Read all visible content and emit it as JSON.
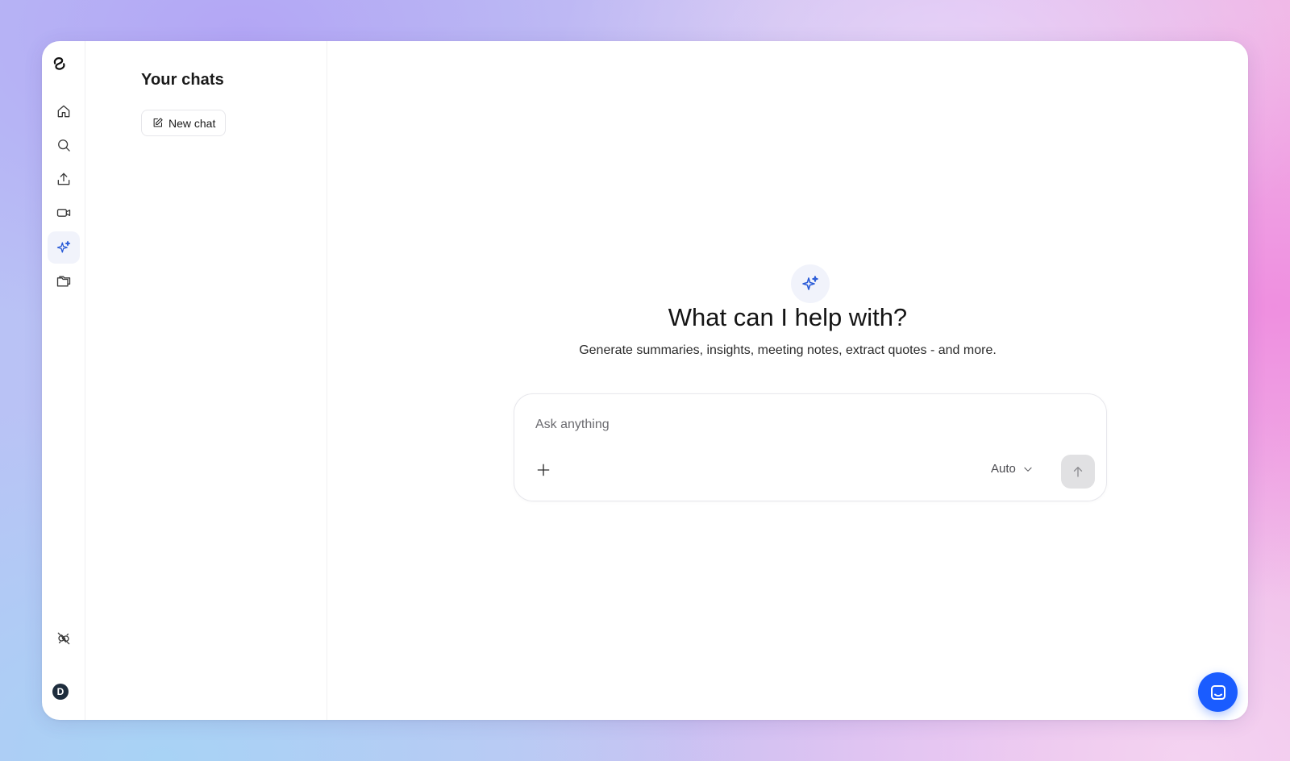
{
  "sidebar": {
    "nav": [
      {
        "icon": "home-icon",
        "label": "Home"
      },
      {
        "icon": "search-icon",
        "label": "Search"
      },
      {
        "icon": "upload-icon",
        "label": "Upload"
      },
      {
        "icon": "video-icon",
        "label": "Recordings"
      },
      {
        "icon": "sparkles-icon",
        "label": "AI chat",
        "active": true
      },
      {
        "icon": "folders-icon",
        "label": "Folders"
      }
    ],
    "bottom": {
      "integrations_icon": "plug-off-icon",
      "avatar_initial": "D"
    }
  },
  "chats_panel": {
    "title": "Your chats",
    "new_chat_label": "New chat"
  },
  "main": {
    "headline": "What can I help with?",
    "subline": "Generate summaries, insights, meeting notes, extract quotes - and more.",
    "composer": {
      "placeholder": "Ask anything",
      "mode_selected": "Auto"
    }
  },
  "colors": {
    "accent": "#2a5bd7",
    "help_bubble": "#1a5cff",
    "avatar_bg": "#1e2d3d",
    "send_disabled": "#e1e1e3"
  }
}
